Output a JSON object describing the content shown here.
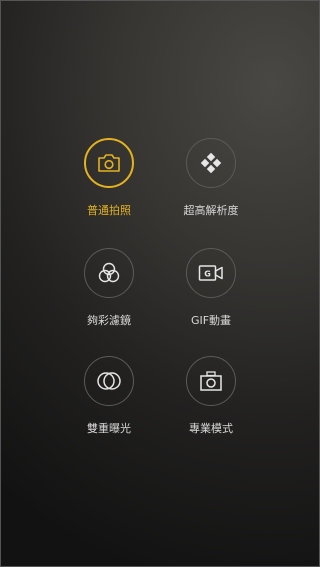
{
  "camera_modes": [
    {
      "label": "普通拍照",
      "icon": "camera-icon",
      "active": true
    },
    {
      "label": "超高解析度",
      "icon": "super-resolution-icon",
      "active": false
    },
    {
      "label": "夠彩濾鏡",
      "icon": "color-filter-icon",
      "active": false
    },
    {
      "label": "GIF動畫",
      "icon": "gif-animation-icon",
      "active": false
    },
    {
      "label": "雙重曝光",
      "icon": "double-exposure-icon",
      "active": false
    },
    {
      "label": "專業模式",
      "icon": "pro-mode-camera-icon",
      "active": false
    }
  ],
  "colors": {
    "accent": "#e3b21e",
    "icon": "#e6e6e6",
    "ring": "#5a5a58",
    "label": "#d8d8d8"
  },
  "gif_icon_letter": "G"
}
